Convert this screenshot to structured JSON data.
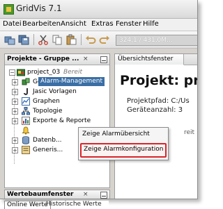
{
  "window": {
    "title": "GridVis 7.1"
  },
  "menubar": {
    "items": [
      "Datei",
      "Bearbeiten",
      "Ansicht",
      "Extras",
      "Fenster",
      "Hilfe"
    ]
  },
  "toolbar": {
    "coordinate_readout": "324,1 / 431,0M..."
  },
  "project_panel": {
    "title": "Projekte - Gruppe ...",
    "close_glyph": "×",
    "root": {
      "name": "project_03",
      "status": "Bereit"
    },
    "items": [
      {
        "label": "Geräte",
        "icon": "devices-icon"
      },
      {
        "label": "Jasic Vorlagen",
        "icon": "jasic-icon"
      },
      {
        "label": "Graphen",
        "icon": "graph-icon"
      },
      {
        "label": "Topologie",
        "icon": "topology-icon"
      },
      {
        "label": "Exporte & Reporte",
        "icon": "export-icon"
      },
      {
        "label": "Alarm-Management",
        "icon": "alarm-icon"
      },
      {
        "label": "Datenb...",
        "icon": "database-icon"
      },
      {
        "label": "Generis...",
        "icon": "generic-icon"
      }
    ]
  },
  "overview": {
    "tab_label": "Übersichtsfenster",
    "heading": "Projekt: pr",
    "path_line": "Projektpfad: C:/Us",
    "device_count_line": "Geräteanzahl: 3",
    "status_fragment": "reit"
  },
  "context_menu": {
    "items": [
      "Zeige Alarmübersicht",
      "Zeige Alarmkonfiguration"
    ],
    "highlight_color": "#d8242a"
  },
  "tree_panel": {
    "title": "Wertebaumfenster",
    "close_glyph": "×",
    "tabs": [
      "Online Werte",
      "Historische Werte"
    ]
  },
  "colors": {
    "selection": "#3a6ea5",
    "accent_red": "#d8242a"
  }
}
